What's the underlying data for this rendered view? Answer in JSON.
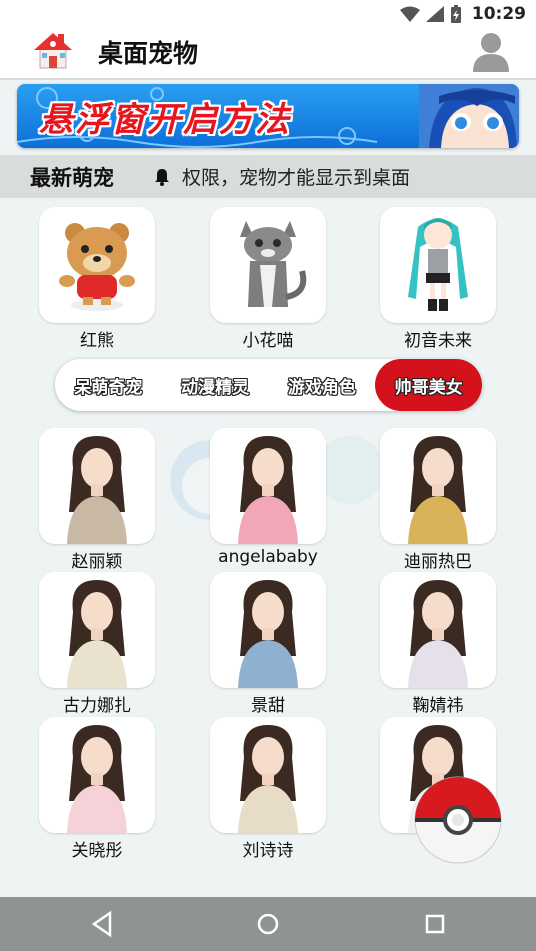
{
  "status": {
    "time": "10:29"
  },
  "appbar": {
    "title": "桌面宠物"
  },
  "banner": {
    "text": "悬浮窗开启方法"
  },
  "notice": {
    "title": "最新萌宠",
    "marquee": "权限，宠物才能显示到桌面"
  },
  "pets_top": [
    {
      "label": "红熊",
      "icon": "red-bear-pet"
    },
    {
      "label": "小花喵",
      "icon": "kitten-pet"
    },
    {
      "label": "初音未来",
      "icon": "miku-pet"
    }
  ],
  "categories": [
    {
      "label": "呆萌奇宠",
      "active": false
    },
    {
      "label": "动漫精灵",
      "active": false
    },
    {
      "label": "游戏角色",
      "active": false
    },
    {
      "label": "帅哥美女",
      "active": true
    }
  ],
  "pets_grid": [
    {
      "label": "赵丽颖",
      "accent": "#c9b9a4"
    },
    {
      "label": "angelababy",
      "accent": "#f2a7b9"
    },
    {
      "label": "迪丽热巴",
      "accent": "#d8b35a"
    },
    {
      "label": "古力娜扎",
      "accent": "#e9e2cf"
    },
    {
      "label": "景甜",
      "accent": "#8fb0cf"
    },
    {
      "label": "鞠婧祎",
      "accent": "#e6e0ea"
    },
    {
      "label": "关晓彤",
      "accent": "#f4d2d8"
    },
    {
      "label": "刘诗诗",
      "accent": "#e7dcc6"
    },
    {
      "label": "",
      "accent": "#f0f0f0"
    }
  ],
  "colors": {
    "accent": "#d3121b",
    "navbar": "#8e9393"
  }
}
